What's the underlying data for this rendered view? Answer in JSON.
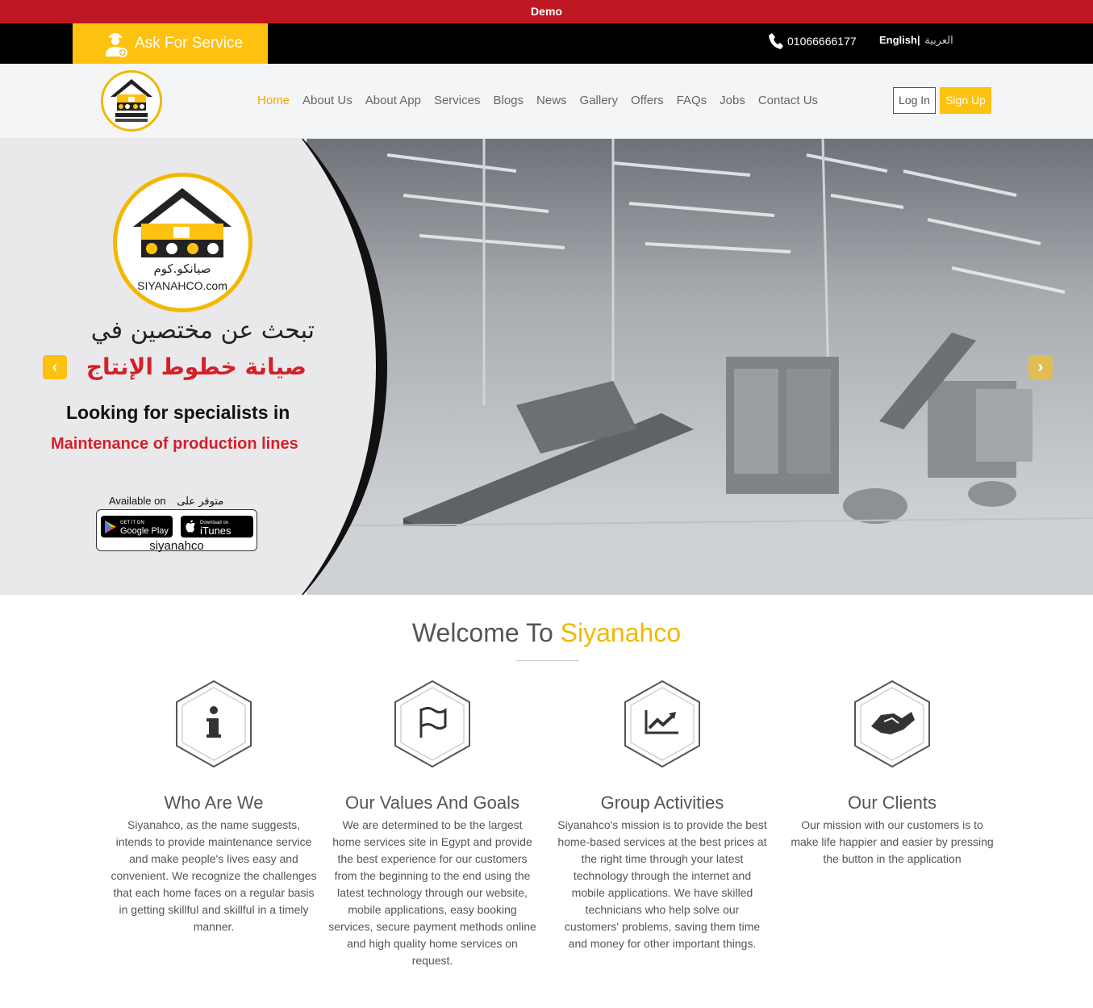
{
  "demo_bar": {
    "label": "Demo"
  },
  "topbar": {
    "ask_service": "Ask For Service",
    "phone": "01066666177",
    "lang_en": "English|",
    "lang_ar": "العربية"
  },
  "nav": {
    "items": [
      "Home",
      "About Us",
      "About App",
      "Services",
      "Blogs",
      "News",
      "Gallery",
      "Offers",
      "FAQs",
      "Jobs",
      "Contact Us"
    ],
    "active": "Home",
    "login": "Log In",
    "signup": "Sign Up"
  },
  "hero": {
    "ar_line1": "تبحث عن مختصين في",
    "ar_line2": "صيانة خطوط الإنتاج",
    "en_line1": "Looking for specialists in",
    "en_line2": "Maintenance of production lines",
    "available_on": "Available on",
    "available_ar": "متوفر على",
    "google_play_small": "GET IT ON",
    "google_play": "Google Play",
    "itunes_small": "Download on",
    "itunes": "iTunes",
    "handle": "siyanahco",
    "logo_ar": "صيانكو.كوم",
    "logo_en": "SIYANAHCO.com",
    "arrow_prev": "‹",
    "arrow_next": "›"
  },
  "welcome": {
    "prefix": "Welcome To",
    "brand": "Siyanahco"
  },
  "features": [
    {
      "icon": "info-icon",
      "title": "Who Are We",
      "text": "Siyanahco, as the name suggests, intends to provide maintenance service and make people's lives easy and convenient. We recognize the challenges that each home faces on a regular basis in getting skillful and skillful in a timely manner."
    },
    {
      "icon": "flag-icon",
      "title": "Our Values And Goals",
      "text": "We are determined to be the largest home services site in Egypt and provide the best experience for our customers from the beginning to the end using the latest technology through our website, mobile applications, easy booking services, secure payment methods online and high quality home services on request."
    },
    {
      "icon": "chart-icon",
      "title": "Group Activities",
      "text": "Siyanahco's mission is to provide the best home-based services at the best prices at the right time through your latest technology through the internet and mobile applications. We have skilled technicians who help solve our customers' problems, saving them time and money for other important things."
    },
    {
      "icon": "handshake-icon",
      "title": "Our Clients",
      "text": "Our mission with our customers is to make life happier and easier by pressing the button in the application"
    }
  ]
}
